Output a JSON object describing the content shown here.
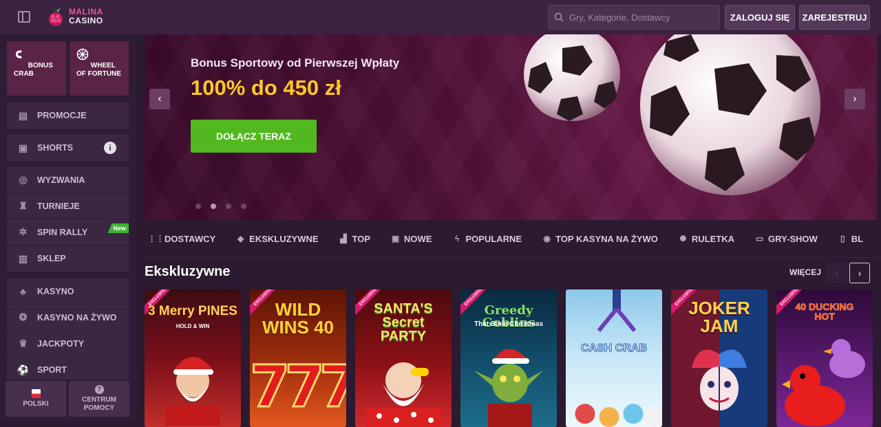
{
  "header": {
    "logo_line1": "MALINA",
    "logo_line2": "CASINO",
    "search_placeholder": "Gry, Kategorie, Dostawcy",
    "login_label": "ZALOGUJ SIĘ",
    "register_label": "ZAREJESTRUJ"
  },
  "sidebar": {
    "tiles": [
      {
        "label": "BONUS CRAB",
        "icon": "crab-icon"
      },
      {
        "label": "WHEEL OF FORTUNE",
        "icon": "wheel-icon"
      }
    ],
    "group1": [
      {
        "label": "PROMOCJE",
        "icon": "gift-icon"
      }
    ],
    "group2": [
      {
        "label": "SHORTS",
        "icon": "film-icon"
      }
    ],
    "group3": [
      {
        "label": "WYZWANIA",
        "icon": "target-icon"
      },
      {
        "label": "TURNIEJE",
        "icon": "trophy-icon"
      },
      {
        "label": "SPIN RALLY",
        "icon": "rally-icon",
        "badge": "New"
      },
      {
        "label": "SKLEP",
        "icon": "shop-icon"
      }
    ],
    "group4": [
      {
        "label": "KASYNO",
        "icon": "cherries-icon"
      },
      {
        "label": "KASYNO NA ŻYWO",
        "icon": "chip-icon"
      },
      {
        "label": "JACKPOTY",
        "icon": "jackpot-icon"
      },
      {
        "label": "SPORT",
        "icon": "ball-icon"
      }
    ],
    "bottom": {
      "language_label": "POLSKI",
      "help_label": "CENTRUM POMOCY"
    }
  },
  "hero": {
    "subtitle": "Bonus Sportowy od Pierwszej Wpłaty",
    "title": "100% do 450 zł",
    "cta_label": "DOŁĄCZ TERAZ",
    "slides_count": 4,
    "active_slide": 2
  },
  "categories": [
    {
      "label": "DOSTAWCY",
      "icon": "grid-icon"
    },
    {
      "label": "EKSKLUZYWNE",
      "icon": "diamond-icon"
    },
    {
      "label": "TOP",
      "icon": "podium-icon"
    },
    {
      "label": "NOWE",
      "icon": "new-icon"
    },
    {
      "label": "POPULARNE",
      "icon": "bolt-icon"
    },
    {
      "label": "TOP KASYNA NA ŻYWO",
      "icon": "live-icon"
    },
    {
      "label": "RULETKA",
      "icon": "roulette-icon"
    },
    {
      "label": "GRY-SHOW",
      "icon": "tv-icon"
    },
    {
      "label": "BL",
      "icon": "cards-icon"
    }
  ],
  "exclusive": {
    "title": "Ekskluzywne",
    "more_label": "WIĘCEJ",
    "games": [
      {
        "title": "3 Merry PINES",
        "sub": "HOLD & WIN",
        "exclusive": true,
        "colors": [
          "#7a0f1a",
          "#e8463a"
        ]
      },
      {
        "title": "WILD WINS 40",
        "sub": "",
        "exclusive": true,
        "colors": [
          "#8a1d07",
          "#e3581f"
        ]
      },
      {
        "title": "SANTA'S Secret PARTY",
        "sub": "",
        "exclusive": true,
        "colors": [
          "#7d0c14",
          "#d02a2e"
        ]
      },
      {
        "title": "Greedy Goblins",
        "sub": "That Stole Christmas",
        "exclusive": true,
        "colors": [
          "#0f3a55",
          "#1d6d8a"
        ]
      },
      {
        "title": "CASH CRAB",
        "sub": "",
        "exclusive": false,
        "colors": [
          "#9fd3ef",
          "#e9f6fc"
        ]
      },
      {
        "title": "JOKER JAM",
        "sub": "",
        "exclusive": true,
        "colors": [
          "#1c2d6e",
          "#b3275a"
        ]
      },
      {
        "title": "40 DUCKING HOT",
        "sub": "",
        "exclusive": true,
        "colors": [
          "#3d0f4a",
          "#7c2795"
        ]
      }
    ],
    "exclusive_badge": "EXCLUSIVE"
  },
  "colors": {
    "accent": "#ffc829",
    "cta": "#52b81f",
    "brand": "#e05a9b",
    "badge_new": "#3fb233"
  }
}
